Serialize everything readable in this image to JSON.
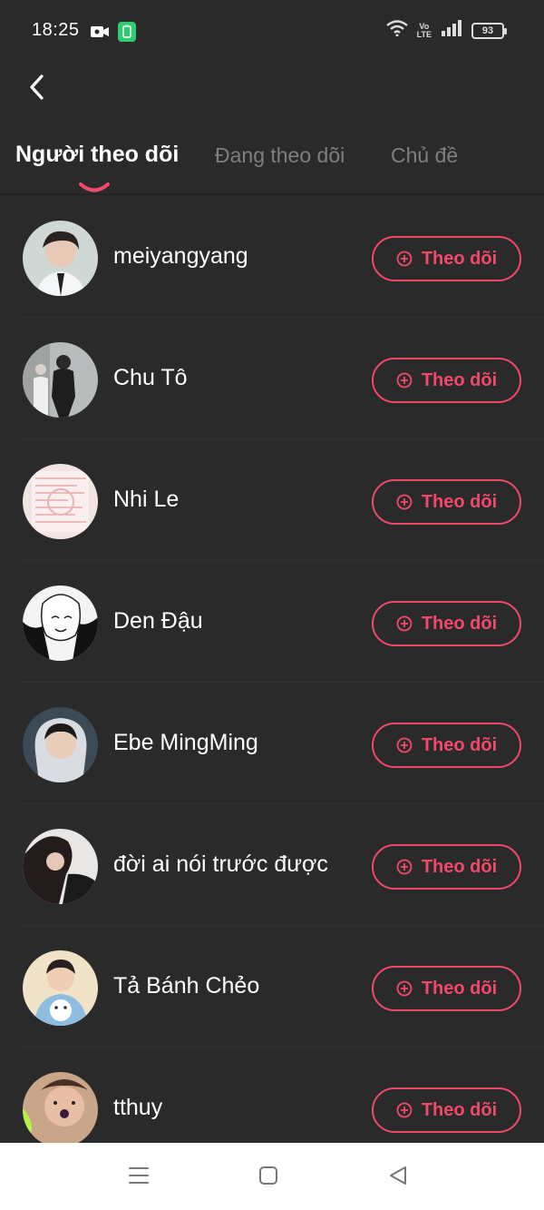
{
  "status_bar": {
    "time": "18:25",
    "battery": "93",
    "volte_top": "Vo",
    "volte_bottom": "LTE"
  },
  "tabs": [
    {
      "label": "Người theo dõi",
      "active": true
    },
    {
      "label": "Đang theo dõi",
      "active": false
    },
    {
      "label": "Chủ đề",
      "active": false
    }
  ],
  "users": [
    {
      "name": "meiyangyang",
      "button": "Theo dõi"
    },
    {
      "name": "Chu Tô",
      "button": "Theo dõi"
    },
    {
      "name": "Nhi Le",
      "button": "Theo dõi"
    },
    {
      "name": "Den Đậu",
      "button": "Theo dõi"
    },
    {
      "name": "Ebe MingMing",
      "button": "Theo dõi"
    },
    {
      "name": "đời ai nói trước được",
      "button": "Theo dõi"
    },
    {
      "name": "Tả Bánh Chẻo",
      "button": "Theo dõi"
    },
    {
      "name": "tthuy",
      "button": "Theo dõi"
    }
  ],
  "colors": {
    "background": "#2a2a2b",
    "accent": "#f2496b",
    "inactive_tab": "#7f7f80"
  },
  "icons": {
    "back": "chevron-left-icon",
    "follow": "plus-circle-icon",
    "nav_menu": "menu-icon",
    "nav_home": "square-home-icon",
    "nav_back": "triangle-back-icon"
  }
}
